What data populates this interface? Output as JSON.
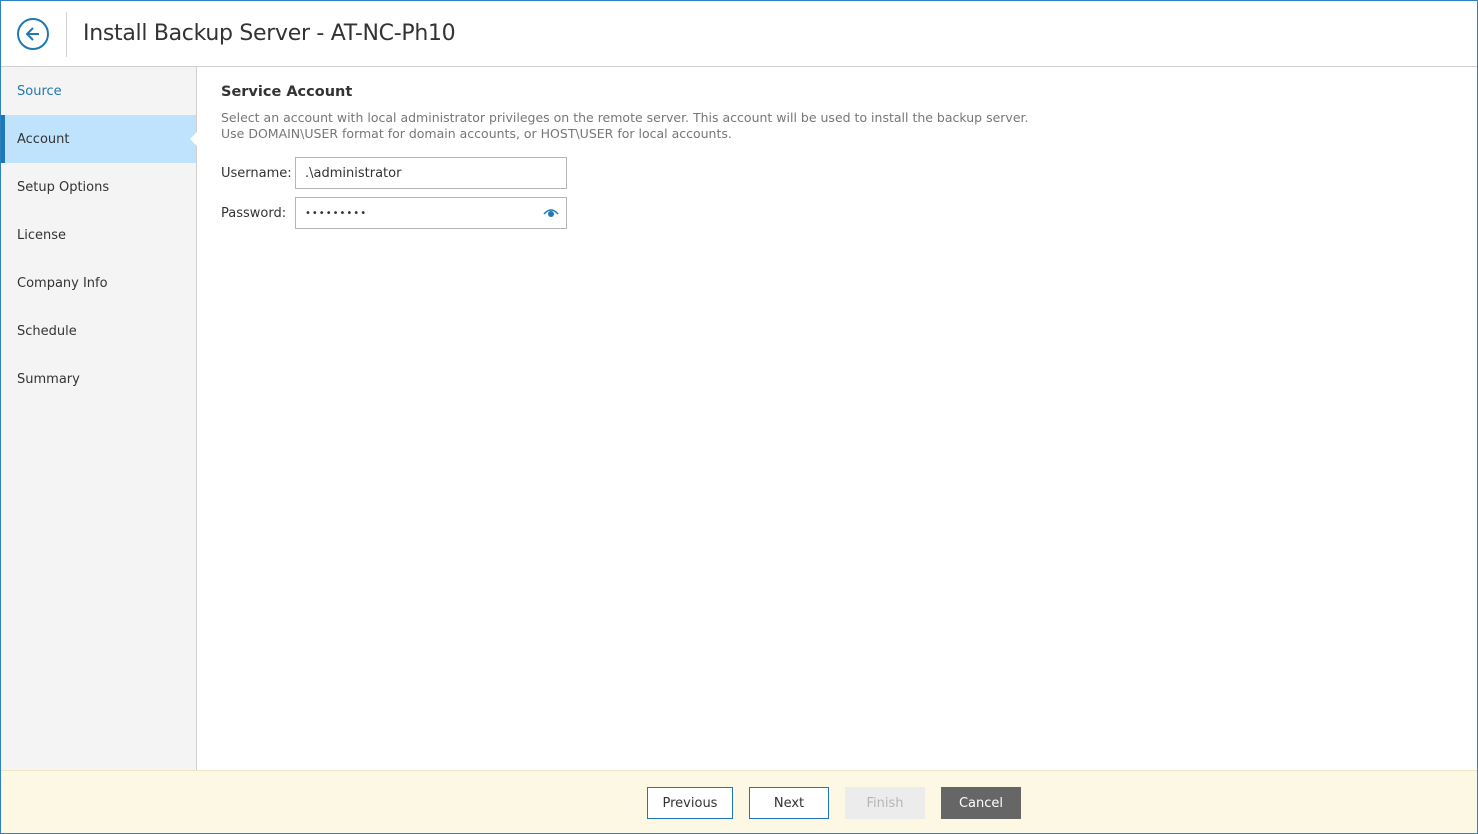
{
  "header": {
    "title": "Install Backup Server - AT-NC-Ph10"
  },
  "sidebar": {
    "items": [
      {
        "label": "Source",
        "state": "done"
      },
      {
        "label": "Account",
        "state": "active"
      },
      {
        "label": "Setup Options",
        "state": "pending"
      },
      {
        "label": "License",
        "state": "pending"
      },
      {
        "label": "Company Info",
        "state": "pending"
      },
      {
        "label": "Schedule",
        "state": "pending"
      },
      {
        "label": "Summary",
        "state": "pending"
      }
    ]
  },
  "main": {
    "section_title": "Service Account",
    "description": "Select an account with local administrator privileges on the remote server. This account will be used to install the backup server. Use DOMAIN\\USER format for domain accounts, or HOST\\USER for local accounts.",
    "username": {
      "label": "Username:",
      "value": ".\\administrator"
    },
    "password": {
      "label": "Password:",
      "value": "•••••••••"
    }
  },
  "footer": {
    "previous_label": "Previous",
    "next_label": "Next",
    "finish_label": "Finish",
    "cancel_label": "Cancel"
  },
  "colors": {
    "accent": "#1f78b4",
    "active_nav": "#bfe3fc",
    "footer_bg": "#fcf8e3",
    "cancel_bg": "#666666"
  },
  "icons": {
    "back": "back-arrow-icon",
    "show_password": "eye-icon"
  }
}
